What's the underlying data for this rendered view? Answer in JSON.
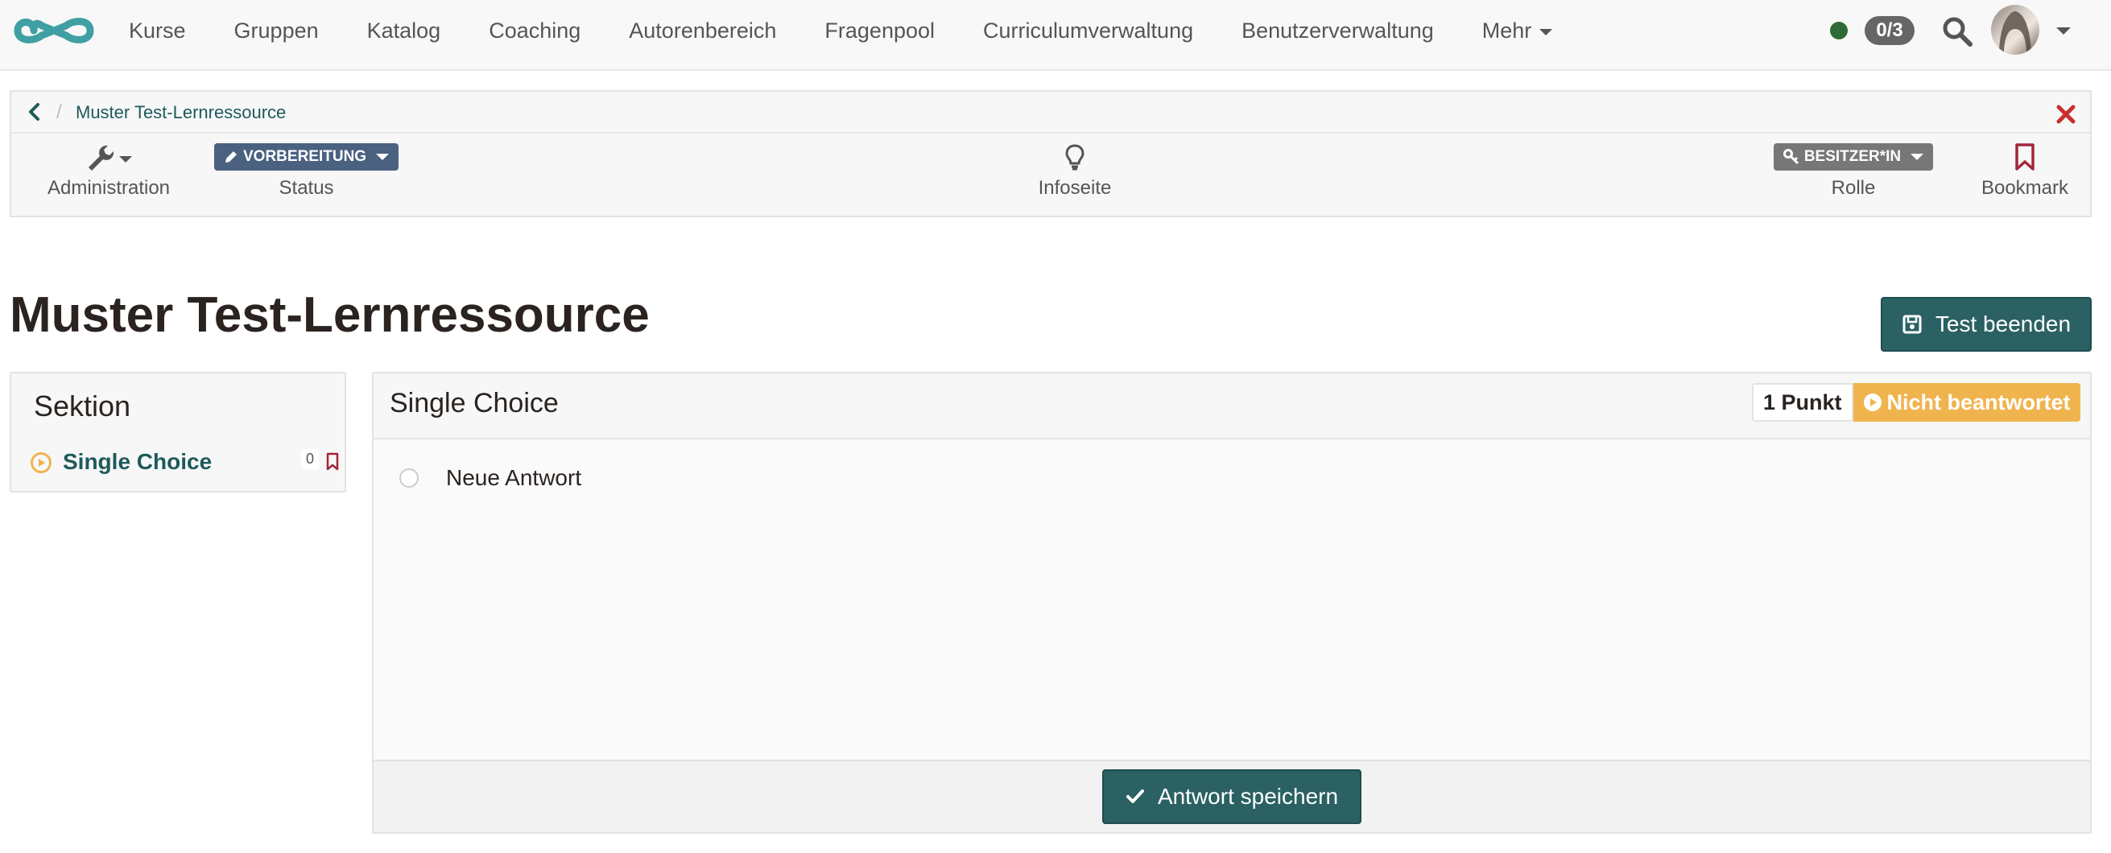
{
  "colors": {
    "primary": "#2b6163",
    "link": "#1e5a5a",
    "status_preparation": "#4a6180",
    "warning": "#f0b44e",
    "online": "#2f6b36",
    "danger": "#c9302c"
  },
  "navbar": {
    "logo_icon": "infinity-logo-icon",
    "links": [
      "Kurse",
      "Gruppen",
      "Katalog",
      "Coaching",
      "Autorenbereich",
      "Fragenpool",
      "Curriculumverwaltung",
      "Benutzerverwaltung"
    ],
    "more_label": "Mehr",
    "badge_count": "0/3"
  },
  "toolbar": {
    "breadcrumb": "Muster Test-Lernressource",
    "administration_label": "Administration",
    "status_value": "VORBEREITUNG",
    "status_label": "Status",
    "info_label": "Infoseite",
    "role_value": "BESITZER*IN",
    "role_label": "Rolle",
    "bookmark_label": "Bookmark"
  },
  "page": {
    "title": "Muster Test-Lernressource",
    "end_test_label": "Test beenden"
  },
  "section": {
    "title": "Sektion",
    "items": [
      {
        "label": "Single Choice",
        "count": "0"
      }
    ]
  },
  "question": {
    "title": "Single Choice",
    "points": "1 Punkt",
    "state": "Nicht beantwortet",
    "answers": [
      "Neue Antwort"
    ],
    "save_label": "Antwort speichern"
  }
}
